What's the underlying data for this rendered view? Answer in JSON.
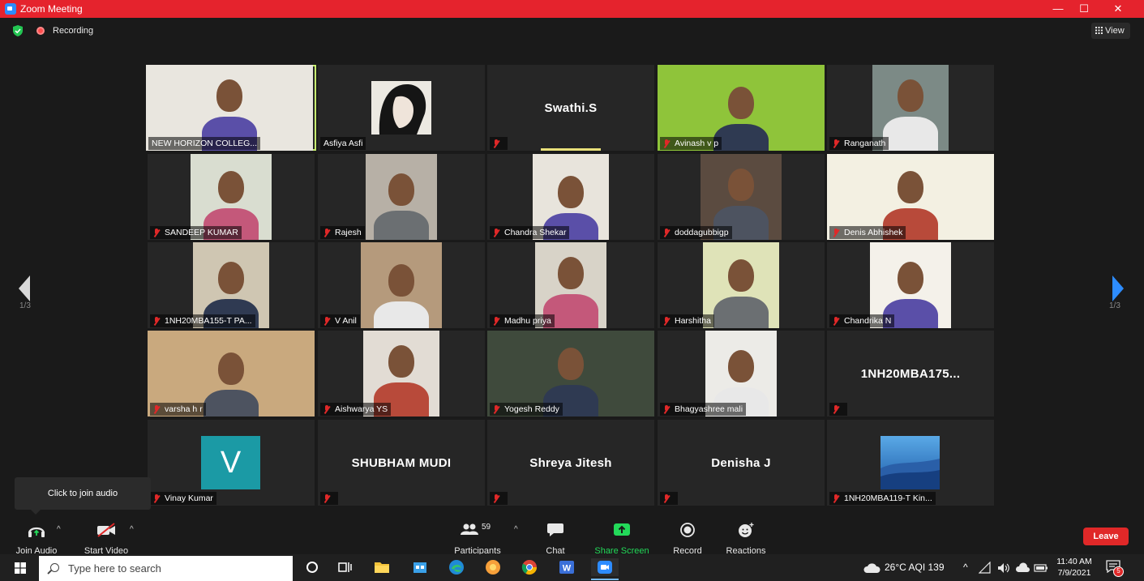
{
  "window": {
    "title": "Zoom Meeting",
    "minimize": "—",
    "maximize": "☐",
    "close": "✕"
  },
  "status": {
    "recording_label": "Recording",
    "view_label": "View"
  },
  "gallery": {
    "page_indicator_left": "1/3",
    "page_indicator_right": "1/3",
    "tiles": [
      {
        "label": "NEW HORIZON COLLEG...",
        "muted": false,
        "active": true,
        "kind": "video",
        "bg": "#e9e6df"
      },
      {
        "label": "Asfiya Asfi",
        "muted": false,
        "kind": "image",
        "bg": "#262626"
      },
      {
        "label": "",
        "big_name": "Swathi.S",
        "muted": true,
        "speaking": true,
        "kind": "name"
      },
      {
        "label": "Avinash v p",
        "muted": true,
        "kind": "video",
        "bg": "#8fc43a"
      },
      {
        "label": "Ranganath",
        "muted": true,
        "kind": "video",
        "bg": "#7c8a86"
      },
      {
        "label": "SANDEEP KUMAR",
        "muted": true,
        "kind": "video",
        "bg": "#d9ddd0"
      },
      {
        "label": "Rajesh",
        "muted": true,
        "kind": "video",
        "bg": "#b7b0a6"
      },
      {
        "label": "Chandra Shekar",
        "muted": true,
        "kind": "video",
        "bg": "#e8e4dc"
      },
      {
        "label": "doddagubbigp",
        "muted": true,
        "kind": "video",
        "bg": "#5b4b40"
      },
      {
        "label": "Denis Abhishek",
        "muted": true,
        "kind": "video",
        "bg": "#f3f0e2"
      },
      {
        "label": "1NH20MBA155-T PA...",
        "muted": true,
        "kind": "video",
        "bg": "#cfc6b2"
      },
      {
        "label": "V Anil",
        "muted": true,
        "kind": "video",
        "bg": "#b59a7c"
      },
      {
        "label": "Madhu priya",
        "muted": true,
        "kind": "video",
        "bg": "#d8d3c8"
      },
      {
        "label": "Harshitha",
        "muted": true,
        "kind": "video",
        "bg": "#dfe3b8"
      },
      {
        "label": "Chandrika N",
        "muted": true,
        "kind": "video",
        "bg": "#f4f1ea"
      },
      {
        "label": "varsha h r",
        "muted": true,
        "kind": "video",
        "bg": "#c9a97e"
      },
      {
        "label": "Aishwarya YS",
        "muted": true,
        "kind": "video",
        "bg": "#e2dcd4"
      },
      {
        "label": "Yogesh Reddy",
        "muted": true,
        "kind": "video",
        "bg": "#3f4a3c"
      },
      {
        "label": "Bhagyashree mali",
        "muted": true,
        "kind": "video",
        "bg": "#ecebe7"
      },
      {
        "label": "",
        "big_name": "1NH20MBA175...",
        "muted": true,
        "kind": "name"
      },
      {
        "label": "Vinay Kumar",
        "muted": true,
        "kind": "avatar",
        "avatar_letter": "V",
        "avatar_color": "#1b9aa5"
      },
      {
        "label": "",
        "big_name": "SHUBHAM MUDI",
        "muted": true,
        "kind": "name"
      },
      {
        "label": "",
        "big_name": "Shreya Jitesh",
        "muted": true,
        "kind": "name"
      },
      {
        "label": "",
        "big_name": "Denisha J",
        "muted": true,
        "kind": "name"
      },
      {
        "label": "1NH20MBA119-T Kin...",
        "muted": true,
        "kind": "avatar-img"
      }
    ]
  },
  "tooltip": "Click to join audio",
  "toolbar": {
    "join_audio": "Join Audio",
    "start_video": "Start Video",
    "participants": "Participants",
    "participants_count": "59",
    "chat": "Chat",
    "share_screen": "Share Screen",
    "record": "Record",
    "reactions": "Reactions",
    "leave": "Leave",
    "caret": "^"
  },
  "taskbar": {
    "search_placeholder": "Type here to search",
    "weather": "26°C AQI 139",
    "time": "11:40 AM",
    "date": "7/9/2021",
    "notif_count": "5"
  },
  "colors": {
    "titlebar": "#e5232d",
    "share_screen": "#23d959",
    "leave": "#e02828",
    "active_speaker": "#c8f070"
  }
}
